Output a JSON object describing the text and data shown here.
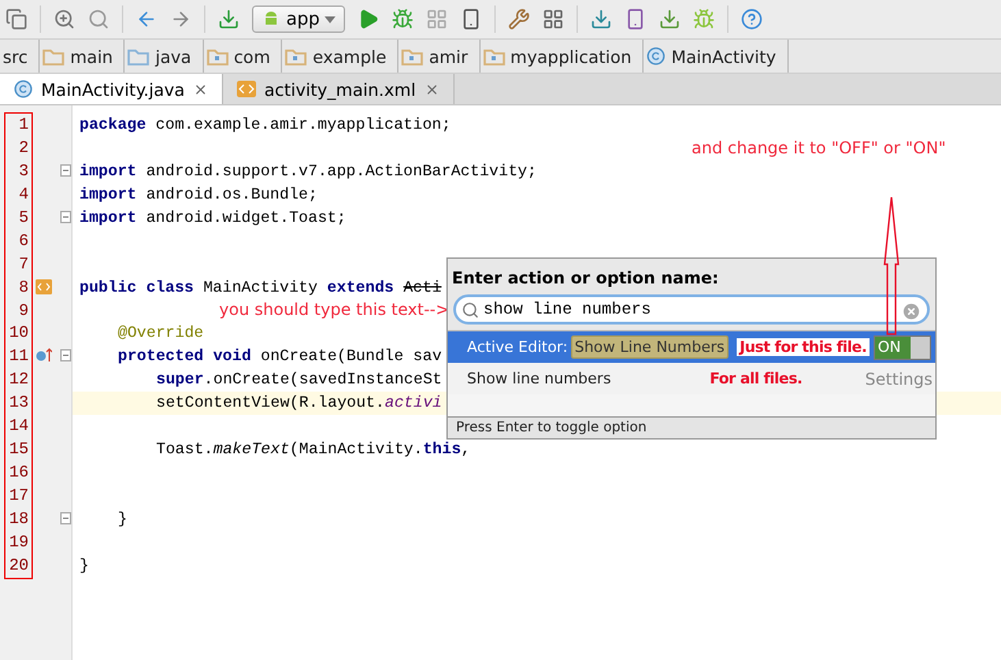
{
  "toolbar": {
    "run_config": "app"
  },
  "breadcrumbs": [
    {
      "label": "src",
      "kind": "plain"
    },
    {
      "label": "main",
      "kind": "folder"
    },
    {
      "label": "java",
      "kind": "source"
    },
    {
      "label": "com",
      "kind": "package"
    },
    {
      "label": "example",
      "kind": "package"
    },
    {
      "label": "amir",
      "kind": "package"
    },
    {
      "label": "myapplication",
      "kind": "package"
    },
    {
      "label": "MainActivity",
      "kind": "class"
    }
  ],
  "tabs": [
    {
      "label": "MainActivity.java",
      "kind": "class",
      "selected": true
    },
    {
      "label": "activity_main.xml",
      "kind": "layout",
      "selected": false
    }
  ],
  "editor": {
    "lines": [
      {
        "number": "1",
        "current": false,
        "fold": false,
        "kind": "top",
        "tokens": [
          {
            "kind": "keyword",
            "text": "package"
          },
          {
            "kind": "plain",
            "text": " com.example.amir.myapplication;"
          }
        ]
      },
      {
        "number": "2",
        "current": false,
        "fold": false,
        "kind": "top"
      },
      {
        "number": "3",
        "current": false,
        "fold": true,
        "kind": "top",
        "tokens": [
          {
            "kind": "keyword",
            "text": "import"
          },
          {
            "kind": "plain",
            "text": " android.support.v7.app.ActionBarActivity;"
          }
        ]
      },
      {
        "number": "4",
        "current": false,
        "fold": false,
        "kind": "top",
        "tokens": [
          {
            "kind": "keyword",
            "text": "import"
          },
          {
            "kind": "plain",
            "text": " android.os.Bundle;"
          }
        ]
      },
      {
        "number": "5",
        "current": false,
        "fold": true,
        "kind": "top",
        "tokens": [
          {
            "kind": "keyword",
            "text": "import"
          },
          {
            "kind": "plain",
            "text": " android.widget.Toast;"
          }
        ]
      },
      {
        "number": "6",
        "current": false,
        "fold": false,
        "kind": "top"
      },
      {
        "number": "7",
        "current": false,
        "fold": false,
        "kind": "top"
      },
      {
        "number": "8",
        "current": false,
        "fold": false,
        "kind": "top",
        "layout_marker": true,
        "tokens": [
          {
            "kind": "keyword",
            "text": "public class"
          },
          {
            "kind": "plain",
            "text": " MainActivity "
          },
          {
            "kind": "keyword",
            "text": "extends "
          },
          {
            "kind": "deprecated",
            "text": "Acti"
          }
        ]
      },
      {
        "number": "9",
        "current": false,
        "fold": false,
        "kind": "top"
      },
      {
        "number": "10",
        "current": false,
        "fold": false,
        "kind": "member",
        "tokens": [
          {
            "kind": "annotation",
            "text": "@Override"
          }
        ]
      },
      {
        "number": "11",
        "current": false,
        "fold": true,
        "kind": "member",
        "override_marker": true,
        "tokens": [
          {
            "kind": "keyword",
            "text": "protected void"
          },
          {
            "kind": "plain",
            "text": " onCreate(Bundle sav"
          }
        ]
      },
      {
        "number": "12",
        "current": false,
        "fold": false,
        "kind": "statement",
        "tokens": [
          {
            "kind": "keyword",
            "text": "super"
          },
          {
            "kind": "plain",
            "text": ".onCreate(savedInstanceSt"
          }
        ]
      },
      {
        "number": "13",
        "current": true,
        "fold": false,
        "kind": "statement",
        "tokens": [
          {
            "kind": "plain",
            "text": "setContentView(R.layout."
          },
          {
            "kind": "field",
            "text": "activi"
          }
        ]
      },
      {
        "number": "14",
        "current": false,
        "fold": false,
        "kind": "top"
      },
      {
        "number": "15",
        "current": false,
        "fold": false,
        "kind": "statement",
        "tokens": [
          {
            "kind": "plain",
            "text": "Toast."
          },
          {
            "kind": "static",
            "text": "makeText"
          },
          {
            "kind": "plain",
            "text": "(MainActivity."
          },
          {
            "kind": "keyword",
            "text": "this"
          },
          {
            "kind": "plain",
            "text": ","
          }
        ]
      },
      {
        "number": "16",
        "current": false,
        "fold": false,
        "kind": "top"
      },
      {
        "number": "17",
        "current": false,
        "fold": false,
        "kind": "top"
      },
      {
        "number": "18",
        "current": false,
        "fold": true,
        "kind": "member",
        "tokens": [
          {
            "kind": "plain",
            "text": "}"
          }
        ]
      },
      {
        "number": "19",
        "current": false,
        "fold": false,
        "kind": "top"
      },
      {
        "number": "20",
        "current": false,
        "fold": false,
        "kind": "top",
        "tokens": [
          {
            "kind": "plain",
            "text": "}"
          }
        ]
      }
    ]
  },
  "popup": {
    "title": "Enter action or option name:",
    "search": {
      "value": "show line numbers"
    },
    "results": [
      {
        "kind": "toggle",
        "prefix": "Active Editor:",
        "label": "Show Line Numbers",
        "selected": true,
        "on": true,
        "state_label": "ON"
      },
      {
        "kind": "setting",
        "label": "Show line numbers",
        "selected": false,
        "hint": "Settings"
      }
    ],
    "footer": "Press Enter to toggle option"
  },
  "annotations": {
    "type_hint": "you should type this text-->",
    "this_file": "Just for this file.",
    "all_files": "For all files.",
    "change_hint": "and change it to \"OFF\" or  \"ON\""
  }
}
